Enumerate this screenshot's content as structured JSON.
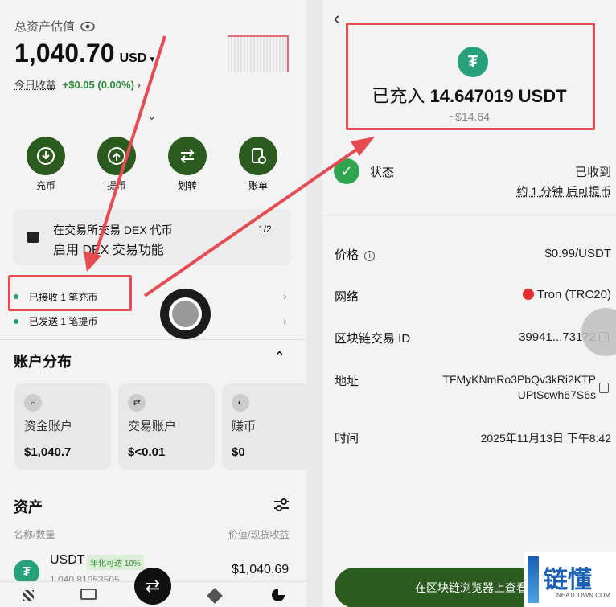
{
  "left": {
    "total_label": "总资产估值",
    "total_value": "1,040.70",
    "total_unit": "USD",
    "today_label": "今日收益",
    "today_value": "+$0.05 (0.00%)",
    "actions": [
      {
        "label": "充币",
        "icon": "download-icon"
      },
      {
        "label": "提币",
        "icon": "upload-icon"
      },
      {
        "label": "划转",
        "icon": "transfer-icon"
      },
      {
        "label": "账单",
        "icon": "bill-icon"
      }
    ],
    "promo": {
      "line1": "在交易所交易 DEX 代币",
      "line2": "启用 DEX 交易功能",
      "pager": "1/2"
    },
    "notices": [
      {
        "text": "已接收 1 笔充币"
      },
      {
        "text": "已发送 1 笔提币"
      }
    ],
    "distribution": {
      "title": "账户分布",
      "accounts": [
        {
          "name": "资金账户",
          "value": "$1,040.7",
          "icon": "wallet-icon"
        },
        {
          "name": "交易账户",
          "value": "$<0.01",
          "icon": "exchange-icon"
        },
        {
          "name": "赚币",
          "value": "$0",
          "icon": "earn-icon"
        }
      ]
    },
    "assets": {
      "title": "资产",
      "col_left": "名称/数量",
      "col_right": "价值/现货收益",
      "rows": [
        {
          "symbol": "USDT",
          "badge": "年化可达 10%",
          "amount": "1,040.81953505",
          "value": "$1,040.69"
        }
      ]
    }
  },
  "right": {
    "deposit_title_prefix": "已充入",
    "deposit_amount": "14.647019 USDT",
    "deposit_usd": "~$14.64",
    "status_label": "状态",
    "status_value": "已收到",
    "status_note": "约 1 分钟 后可提币",
    "rows": [
      {
        "label": "价格",
        "value": "$0.99/USDT"
      },
      {
        "label": "网络",
        "value": "Tron (TRC20)"
      },
      {
        "label": "区块链交易 ID",
        "value": "39941...73172"
      },
      {
        "label": "地址",
        "value": "TFMyKNmRo3PbQv3kRi2KTP\nUPtScwh67S6s"
      },
      {
        "label": "时间",
        "value": "2025年11月13日 下午8:42"
      }
    ],
    "cta": "在区块链浏览器上查看"
  },
  "watermark": {
    "text": "链懂",
    "sub": "NEATDOWN.COM"
  },
  "colors": {
    "accent_green": "#2c5b1f",
    "annotation_red": "#e64b52",
    "tether": "#26a17b",
    "tron": "#e32d2d"
  }
}
